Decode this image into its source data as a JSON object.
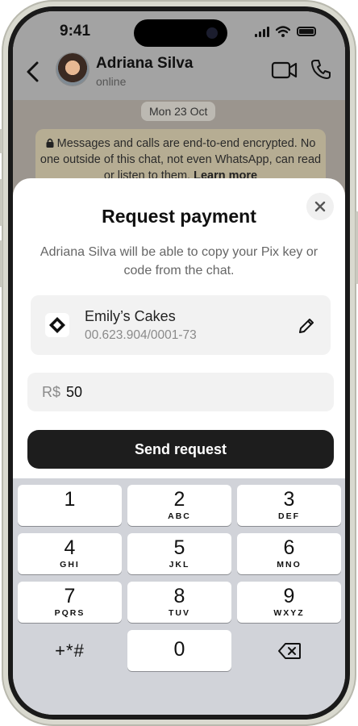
{
  "status_bar": {
    "time": "9:41"
  },
  "chat": {
    "contact_name": "Adriana Silva",
    "contact_status": "online",
    "date_label": "Mon 23 Oct",
    "encryption_notice": "Messages and calls are end-to-end encrypted. No one outside of this chat, not even WhatsApp, can read or listen to them.",
    "encryption_link": "Learn more"
  },
  "sheet": {
    "title": "Request payment",
    "description": "Adriana Silva will be able to copy your Pix key or code from the chat.",
    "pix": {
      "name": "Emily’s Cakes",
      "key": "00.623.904/0001-73"
    },
    "amount": {
      "currency_prefix": "R$",
      "value": "50"
    },
    "send_label": "Send request"
  },
  "keypad": {
    "keys": [
      {
        "num": "1",
        "letters": ""
      },
      {
        "num": "2",
        "letters": "ABC"
      },
      {
        "num": "3",
        "letters": "DEF"
      },
      {
        "num": "4",
        "letters": "GHI"
      },
      {
        "num": "5",
        "letters": "JKL"
      },
      {
        "num": "6",
        "letters": "MNO"
      },
      {
        "num": "7",
        "letters": "PQRS"
      },
      {
        "num": "8",
        "letters": "TUV"
      },
      {
        "num": "9",
        "letters": "WXYZ"
      },
      {
        "num": "0",
        "letters": ""
      }
    ],
    "symbols_label": "+*#"
  },
  "colors": {
    "send_button": "#1d1d1d",
    "sheet": "#ffffff",
    "keypad": "#d1d3d9"
  }
}
